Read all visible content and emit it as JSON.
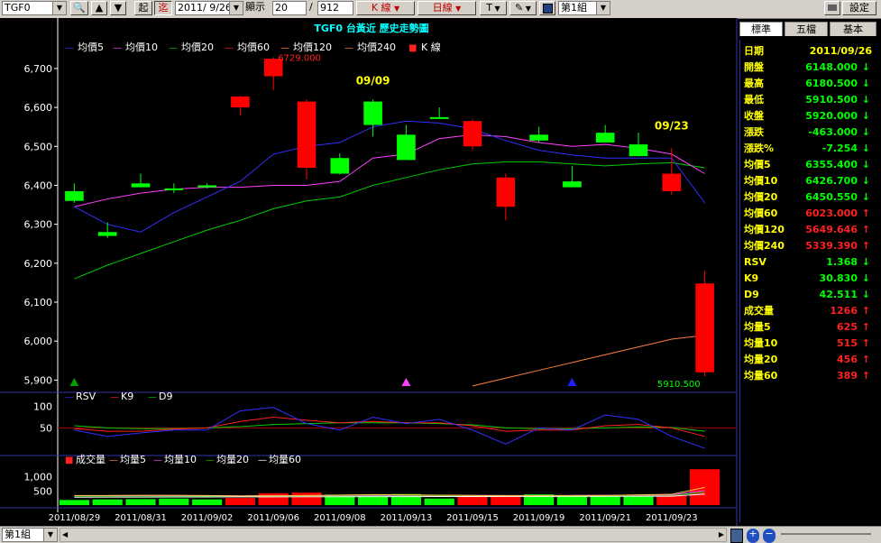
{
  "toolbar": {
    "symbol": "TGF0",
    "start_btn": "起",
    "latest_btn": "迄",
    "date": "2011/ 9/26",
    "display_label": "顯示",
    "display_count": "20",
    "separator": "/",
    "total_count": "912",
    "chart_type": "K 線",
    "period": "日線",
    "text_tool": "T",
    "group": "第1組",
    "settings": "設定"
  },
  "chart_title": "TGF0 台黃近  歷史走勢圖",
  "tabs": [
    "標準",
    "五檔",
    "基本"
  ],
  "status": {
    "group": "第1組"
  },
  "colors": {
    "up": "#ff0000",
    "down": "#00ff00",
    "ma5": "#3030ff",
    "ma10": "#ff40ff",
    "ma20": "#00cc00",
    "ma240": "#ff8040",
    "rsv": "#3030ff",
    "k9": "#ff2020",
    "d9": "#00cc00",
    "accent_yellow": "#ffff00"
  },
  "sidebar": [
    {
      "label": "日期",
      "value": "2011/09/26",
      "color": "#ffff00",
      "arrow": ""
    },
    {
      "label": "開盤",
      "value": "6148.000",
      "color": "#00ff00",
      "arrow": "↓"
    },
    {
      "label": "最高",
      "value": "6180.500",
      "color": "#00ff00",
      "arrow": "↓"
    },
    {
      "label": "最低",
      "value": "5910.500",
      "color": "#00ff00",
      "arrow": "↓"
    },
    {
      "label": "收盤",
      "value": "5920.000",
      "color": "#00ff00",
      "arrow": "↓"
    },
    {
      "label": "漲跌",
      "value": "-463.000",
      "color": "#00ff00",
      "arrow": "↓"
    },
    {
      "label": "漲跌%",
      "value": "-7.254",
      "color": "#00ff00",
      "arrow": "↓"
    },
    {
      "label": "均價5",
      "value": "6355.400",
      "color": "#00ff00",
      "arrow": "↓"
    },
    {
      "label": "均價10",
      "value": "6426.700",
      "color": "#00ff00",
      "arrow": "↓"
    },
    {
      "label": "均價20",
      "value": "6450.550",
      "color": "#00ff00",
      "arrow": "↓"
    },
    {
      "label": "均價60",
      "value": "6023.000",
      "color": "#ff2020",
      "arrow": "↑"
    },
    {
      "label": "均價120",
      "value": "5649.646",
      "color": "#ff2020",
      "arrow": "↑"
    },
    {
      "label": "均價240",
      "value": "5339.390",
      "color": "#ff2020",
      "arrow": "↑"
    },
    {
      "label": "RSV",
      "value": "1.368",
      "color": "#00ff00",
      "arrow": "↓"
    },
    {
      "label": "K9",
      "value": "30.830",
      "color": "#00ff00",
      "arrow": "↓"
    },
    {
      "label": "D9",
      "value": "42.511",
      "color": "#00ff00",
      "arrow": "↓"
    },
    {
      "label": "成交量",
      "value": "1266",
      "color": "#ff2020",
      "arrow": "↑"
    },
    {
      "label": "均量5",
      "value": "625",
      "color": "#ff2020",
      "arrow": "↑"
    },
    {
      "label": "均量10",
      "value": "515",
      "color": "#ff2020",
      "arrow": "↑"
    },
    {
      "label": "均量20",
      "value": "456",
      "color": "#ff2020",
      "arrow": "↑"
    },
    {
      "label": "均量60",
      "value": "389",
      "color": "#ff2020",
      "arrow": "↑"
    }
  ],
  "chart_data": {
    "type": "candlestick",
    "price": {
      "ylim": [
        5880,
        6760
      ],
      "yticks": [
        5900,
        6000,
        6100,
        6200,
        6300,
        6400,
        6500,
        6600,
        6700
      ],
      "ytick_labels": [
        "5,900",
        "6,000",
        "6,100",
        "6,200",
        "6,300",
        "6,400",
        "6,500",
        "6,600",
        "6,700"
      ],
      "legend": [
        "均價5",
        "均價10",
        "均價20",
        "均價60",
        "均價120",
        "均價240",
        "K 線"
      ],
      "candles": [
        {
          "o": 6385,
          "h": 6405,
          "l": 6355,
          "c": 6360
        },
        {
          "o": 6280,
          "h": 6305,
          "l": 6265,
          "c": 6270
        },
        {
          "o": 6405,
          "h": 6430,
          "l": 6395,
          "c": 6395
        },
        {
          "o": 6392,
          "h": 6405,
          "l": 6380,
          "c": 6390
        },
        {
          "o": 6400,
          "h": 6405,
          "l": 6392,
          "c": 6395
        },
        {
          "o": 6600,
          "h": 6630,
          "l": 6580,
          "c": 6628
        },
        {
          "o": 6680,
          "h": 6729,
          "l": 6645,
          "c": 6725
        },
        {
          "o": 6445,
          "h": 6620,
          "l": 6415,
          "c": 6615
        },
        {
          "o": 6470,
          "h": 6482,
          "l": 6428,
          "c": 6430
        },
        {
          "o": 6615,
          "h": 6620,
          "l": 6525,
          "c": 6555
        },
        {
          "o": 6530,
          "h": 6555,
          "l": 6465,
          "c": 6465
        },
        {
          "o": 6575,
          "h": 6600,
          "l": 6572,
          "c": 6572
        },
        {
          "o": 6500,
          "h": 6570,
          "l": 6490,
          "c": 6565
        },
        {
          "o": 6345,
          "h": 6430,
          "l": 6310,
          "c": 6420
        },
        {
          "o": 6530,
          "h": 6550,
          "l": 6510,
          "c": 6515
        },
        {
          "o": 6410,
          "h": 6450,
          "l": 6395,
          "c": 6395
        },
        {
          "o": 6535,
          "h": 6555,
          "l": 6510,
          "c": 6510
        },
        {
          "o": 6505,
          "h": 6535,
          "l": 6475,
          "c": 6475
        },
        {
          "o": 6385,
          "h": 6495,
          "l": 6375,
          "c": 6430
        },
        {
          "o": 5920,
          "h": 6180,
          "l": 5910,
          "c": 6148
        }
      ],
      "ma5": [
        6345,
        6300,
        6280,
        6330,
        6370,
        6410,
        6480,
        6500,
        6510,
        6550,
        6565,
        6560,
        6545,
        6515,
        6490,
        6478,
        6470,
        6470,
        6470,
        6355
      ],
      "ma10": [
        6345,
        6365,
        6380,
        6390,
        6395,
        6395,
        6400,
        6400,
        6410,
        6470,
        6480,
        6520,
        6530,
        6525,
        6510,
        6500,
        6505,
        6495,
        6480,
        6430
      ],
      "ma20": [
        6160,
        6195,
        6225,
        6255,
        6285,
        6310,
        6340,
        6360,
        6370,
        6400,
        6420,
        6440,
        6455,
        6460,
        6460,
        6455,
        6450,
        6455,
        6458,
        6445
      ],
      "ma240_start_idx": 12,
      "ma240": [
        5885,
        5905,
        5925,
        5945,
        5965,
        5985,
        6005,
        6015
      ],
      "annotations": [
        {
          "idx": 6,
          "price": 6729,
          "text": "6729.000",
          "color": "#ff2020"
        },
        {
          "idx": 9,
          "price": 6645,
          "text": "09/09",
          "color": "#ffff00"
        },
        {
          "idx": 18,
          "price": 6530,
          "text": "09/23",
          "color": "#ffff00"
        },
        {
          "idx": 19,
          "price": 5910,
          "text": "5910.500",
          "color": "#00ff00"
        }
      ],
      "markers": [
        {
          "idx": 0,
          "color": "#00a000"
        },
        {
          "idx": 10,
          "color": "#ff40ff"
        },
        {
          "idx": 15,
          "color": "#2020ff"
        }
      ]
    },
    "kd": {
      "legend": [
        "RSV",
        "K9",
        "D9"
      ],
      "ylim": [
        0,
        110
      ],
      "yticks": [
        50,
        100
      ],
      "ytick_labels": [
        "50",
        "100"
      ],
      "rsv": [
        45,
        30,
        38,
        45,
        45,
        90,
        98,
        60,
        45,
        75,
        60,
        70,
        45,
        12,
        50,
        45,
        80,
        70,
        30,
        2
      ],
      "k9": [
        48,
        42,
        42,
        47,
        50,
        65,
        75,
        68,
        62,
        65,
        62,
        62,
        55,
        42,
        45,
        45,
        55,
        58,
        50,
        30
      ],
      "d9": [
        55,
        50,
        48,
        48,
        50,
        53,
        58,
        60,
        62,
        62,
        62,
        60,
        57,
        50,
        48,
        48,
        50,
        52,
        51,
        42
      ]
    },
    "volume": {
      "legend": [
        "成交量",
        "均量5",
        "均量10",
        "均量20",
        "均量60"
      ],
      "ylim": [
        0,
        1400
      ],
      "yticks": [
        500,
        1000
      ],
      "ytick_labels": [
        "500",
        "1,000"
      ],
      "values": [
        180,
        200,
        210,
        230,
        200,
        250,
        420,
        440,
        370,
        320,
        390,
        230,
        350,
        320,
        380,
        310,
        300,
        310,
        360,
        1266
      ],
      "ma5": [
        340,
        340,
        345,
        345,
        340,
        320,
        330,
        340,
        350,
        370,
        360,
        350,
        340,
        330,
        330,
        330,
        340,
        360,
        380,
        625
      ],
      "ma10": [
        330,
        330,
        335,
        335,
        335,
        330,
        330,
        335,
        340,
        345,
        345,
        345,
        345,
        340,
        340,
        340,
        345,
        350,
        360,
        515
      ],
      "ma20": [
        310,
        312,
        314,
        316,
        318,
        320,
        322,
        325,
        328,
        330,
        332,
        334,
        336,
        338,
        340,
        342,
        344,
        346,
        350,
        456
      ],
      "ma60": [
        280,
        282,
        284,
        286,
        288,
        290,
        292,
        294,
        296,
        298,
        300,
        302,
        304,
        306,
        308,
        310,
        312,
        314,
        316,
        389
      ]
    },
    "x_labels": [
      "2011/08/29",
      "2011/08/31",
      "2011/09/02",
      "2011/09/06",
      "2011/09/08",
      "2011/09/13",
      "2011/09/15",
      "2011/09/19",
      "2011/09/21",
      "2011/09/23"
    ],
    "x_label_idx": [
      0,
      2,
      4,
      6,
      8,
      10,
      12,
      14,
      16,
      18
    ]
  }
}
